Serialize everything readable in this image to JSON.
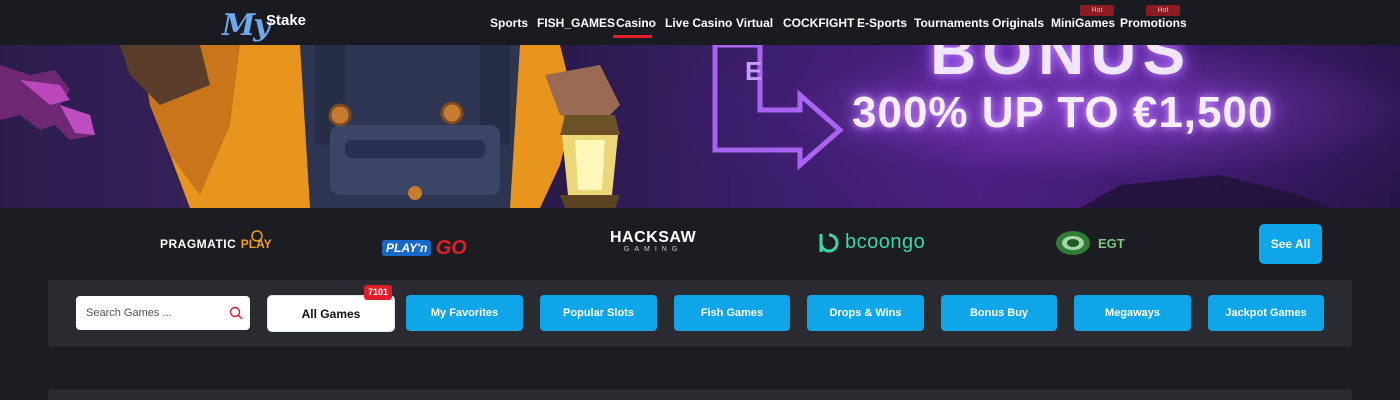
{
  "header": {
    "logo": {
      "my": "My",
      "stake": "Stake"
    },
    "nav": [
      {
        "label": "Sports"
      },
      {
        "label": "FISH_GAMES"
      },
      {
        "label": "Casino",
        "active": true
      },
      {
        "label": "Live Casino"
      },
      {
        "label": "Virtual"
      },
      {
        "label": "COCKFIGHT"
      },
      {
        "label": "E-Sports"
      },
      {
        "label": "Tournaments"
      },
      {
        "label": "Originals"
      },
      {
        "label": "MiniGames",
        "badge": "Hot"
      },
      {
        "label": "Promotions",
        "badge": "Hot"
      }
    ],
    "active_color": "#e2202b"
  },
  "banner": {
    "headline": "BONUS",
    "offer": "300% UP TO €1,500"
  },
  "providers": {
    "items": [
      {
        "name": "PRAGMATIC PLAY",
        "parts": [
          "PRAGMATIC",
          "PLAY"
        ]
      },
      {
        "name": "PLAY'n GO",
        "parts": [
          "PLAY'n",
          "GO"
        ]
      },
      {
        "name": "HACKSAW GAMING",
        "parts": [
          "HACKSAW",
          "GAMING"
        ]
      },
      {
        "name": "booongo",
        "parts": [
          "bcoongo"
        ]
      },
      {
        "name": "EGT",
        "parts": [
          "EGT"
        ]
      }
    ],
    "see_all_label": "See All"
  },
  "filters": {
    "search_placeholder": "Search Games ...",
    "all_games_label": "All Games",
    "all_games_count": "7101",
    "categories": [
      "My Favorites",
      "Popular Slots",
      "Fish Games",
      "Drops & Wins",
      "Bonus Buy",
      "Megaways",
      "Jackpot Games"
    ]
  },
  "colors": {
    "accent": "#0ea5e9",
    "badge_red": "#e11d2c",
    "background": "#1c1d22",
    "panel": "#2a2b30"
  }
}
